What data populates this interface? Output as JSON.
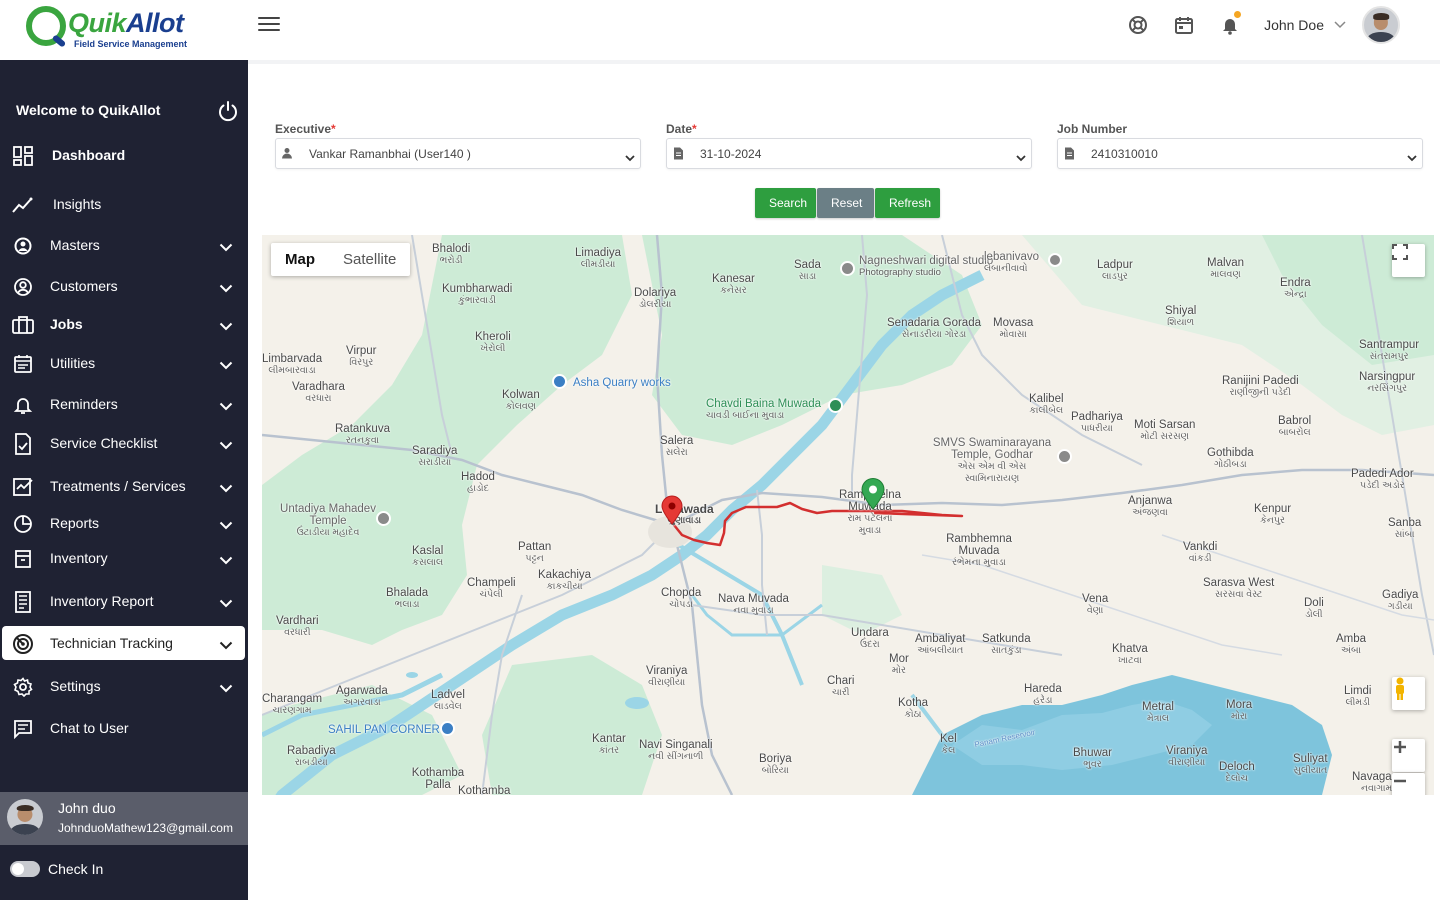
{
  "header": {
    "brand_name_part1": "Quik",
    "brand_name_part2": "Allot",
    "brand_tagline": "Field Service Management",
    "user_name": "John Doe",
    "accent_color": "#3aa53f"
  },
  "sidebar": {
    "welcome": "Welcome to QuikAllot",
    "items": [
      {
        "label": "Dashboard",
        "icon": "dashboard-icon"
      },
      {
        "label": "Insights",
        "icon": "insights-icon"
      },
      {
        "label": "Masters",
        "icon": "masters-icon"
      },
      {
        "label": "Customers",
        "icon": "customers-icon"
      },
      {
        "label": "Jobs",
        "icon": "jobs-icon"
      },
      {
        "label": "Utilities",
        "icon": "utilities-icon"
      },
      {
        "label": "Reminders",
        "icon": "bell-icon"
      },
      {
        "label": "Service Checklist",
        "icon": "checklist-icon"
      },
      {
        "label": "Treatments / Services",
        "icon": "treatments-icon"
      },
      {
        "label": "Reports",
        "icon": "reports-icon"
      },
      {
        "label": "Inventory",
        "icon": "inventory-icon"
      },
      {
        "label": "Inventory Report",
        "icon": "inventory-report-icon"
      },
      {
        "label": "Technician Tracking",
        "icon": "tracking-icon",
        "active": true
      },
      {
        "label": "Settings",
        "icon": "gear-icon"
      },
      {
        "label": "Chat to User",
        "icon": "chat-icon"
      }
    ],
    "user": {
      "name": "John duo",
      "email": "JohnduoMathew123@gmail.com"
    },
    "checkin_label": "Check In"
  },
  "filters": {
    "executive": {
      "label": "Executive",
      "value": "Vankar Ramanbhai (User140 )"
    },
    "date": {
      "label": "Date",
      "value": "31-10-2024"
    },
    "job_number": {
      "label": "Job Number",
      "value": "2410310010"
    },
    "required_mark": "*"
  },
  "buttons": {
    "search": "Search",
    "reset": "Reset",
    "refresh": "Refresh"
  },
  "map": {
    "type_map": "Map",
    "type_satellite": "Satellite",
    "places": [
      {
        "name": "Bhalodi",
        "sub": "ભરોડી"
      },
      {
        "name": "Limadiya",
        "sub": "લીમડીયા"
      },
      {
        "name": "Kanesar",
        "sub": "કનેસર"
      },
      {
        "name": "Sada",
        "sub": "સાડા"
      },
      {
        "name": "Nagneshwari digital studio",
        "sub": "Photography studio"
      },
      {
        "name": "lebanivavo",
        "sub": "લેબાનીવાવો"
      },
      {
        "name": "Ladpur",
        "sub": "લાડપુર"
      },
      {
        "name": "Malvan",
        "sub": "માલવણ"
      },
      {
        "name": "Endra",
        "sub": "એન્દ્રા"
      },
      {
        "name": "Kumbharwadi",
        "sub": "કુંભારવાડી"
      },
      {
        "name": "Dolariya",
        "sub": "ડોલરીયા"
      },
      {
        "name": "Shiyal",
        "sub": "શિયાળ"
      },
      {
        "name": "Kheroli",
        "sub": "ખેરોલી"
      },
      {
        "name": "Senadaria Gorada",
        "sub": "સેનાડરીયા ગોરડા"
      },
      {
        "name": "Movasa",
        "sub": "મોવાસા"
      },
      {
        "name": "Santrampur",
        "sub": "સંતરામપુર"
      },
      {
        "name": "Limbarvada",
        "sub": "લીમબારવાડા"
      },
      {
        "name": "Virpur",
        "sub": "વિરપુર"
      },
      {
        "name": "Asha Quarry works",
        "sub": ""
      },
      {
        "name": "Narsingpur",
        "sub": "નરસિંગપુર"
      },
      {
        "name": "Varadhara",
        "sub": "વરધારા"
      },
      {
        "name": "Kolwan",
        "sub": "કોલવણ"
      },
      {
        "name": "Chavdi Baina Muwada",
        "sub": "ચાવડી બાઈના મુવાડા"
      },
      {
        "name": "Ranijini Padedi",
        "sub": "રાણીજીની પડેદી"
      },
      {
        "name": "Kalibel",
        "sub": "કાલીબેલ"
      },
      {
        "name": "Padhariya",
        "sub": "પાધરીયા"
      },
      {
        "name": "Moti Sarsan",
        "sub": "મોટી સરસણ"
      },
      {
        "name": "Babrol",
        "sub": "બાબરોલ"
      },
      {
        "name": "Ratankuva",
        "sub": "રતનકુવા"
      },
      {
        "name": "Salera",
        "sub": "સલેરા"
      },
      {
        "name": "SMVS Swaminarayana Temple, Godhar",
        "sub": "એસ એમ વી એસ સ્વામિનારાયણ"
      },
      {
        "name": "Gothibda",
        "sub": "ગોઠીબડા"
      },
      {
        "name": "Saradiya",
        "sub": "સરાડીયા"
      },
      {
        "name": "Hadod",
        "sub": "હાડોદ"
      },
      {
        "name": "Padedi Ador",
        "sub": "પડેદી અડોર"
      },
      {
        "name": "Lunawada",
        "sub": "લુણાવાડા"
      },
      {
        "name": "Rampatelna Muwada",
        "sub": "રામ પટેલના મુવાડા"
      },
      {
        "name": "Anjanwa",
        "sub": "અંજણવા"
      },
      {
        "name": "Kenpur",
        "sub": "કેનપુર"
      },
      {
        "name": "Untadiya Mahadev Temple",
        "sub": "ઉંટાડીયા મહાદેવ"
      },
      {
        "name": "Sanba",
        "sub": "સાંબા"
      },
      {
        "name": "Pattan",
        "sub": "પટ્ટન"
      },
      {
        "name": "Kaslal",
        "sub": "કસલાલ"
      },
      {
        "name": "Rambhemna Muvada",
        "sub": "રંભેમના મુવાડા"
      },
      {
        "name": "Vankdi",
        "sub": "વાંકડી"
      },
      {
        "name": "Kakachiya",
        "sub": "કાકચીયા"
      },
      {
        "name": "Champeli",
        "sub": "ચંપેલી"
      },
      {
        "name": "Bhalada",
        "sub": "ભલાડા"
      },
      {
        "name": "Chopda",
        "sub": "ચોપડા"
      },
      {
        "name": "Nava Muvada",
        "sub": "નવા મુવાડા"
      },
      {
        "name": "Sarasva West",
        "sub": "સરસવા વેસ્ટ"
      },
      {
        "name": "Gadiya",
        "sub": "ગડીયા"
      },
      {
        "name": "Vena",
        "sub": "વેણા"
      },
      {
        "name": "Doli",
        "sub": "ડોલી"
      },
      {
        "name": "Vardhari",
        "sub": "વરધારી"
      },
      {
        "name": "Undara",
        "sub": "ઉંદરા"
      },
      {
        "name": "Ambaliyat",
        "sub": "આંબલીયાત"
      },
      {
        "name": "Satkunda",
        "sub": "સાતકુંડા"
      },
      {
        "name": "Amba",
        "sub": "અંબા"
      },
      {
        "name": "Khatva",
        "sub": "ખાટવા"
      },
      {
        "name": "Mor",
        "sub": "મોર"
      },
      {
        "name": "Viraniya",
        "sub": "વીરાણીયા"
      },
      {
        "name": "Chari",
        "sub": "ચારી"
      },
      {
        "name": "Hareda",
        "sub": "હરેડા"
      },
      {
        "name": "Limdi",
        "sub": "લીમડી"
      },
      {
        "name": "Charangam",
        "sub": "ચારણગામ"
      },
      {
        "name": "Agarwada",
        "sub": "અગરવાડા"
      },
      {
        "name": "Ladvel",
        "sub": "લાડવેલ"
      },
      {
        "name": "Kotha",
        "sub": "કોઠા"
      },
      {
        "name": "Metral",
        "sub": "મેત્રાલ"
      },
      {
        "name": "Mora",
        "sub": "મોરા"
      },
      {
        "name": "SAHIL PAN CORNER",
        "sub": ""
      },
      {
        "name": "Kel",
        "sub": "કેલ"
      },
      {
        "name": "Rabadiya",
        "sub": "રાબડીયા"
      },
      {
        "name": "Kantar",
        "sub": "કાંતર"
      },
      {
        "name": "Navi Singanali",
        "sub": "નવી સીંગનાળી"
      },
      {
        "name": "Boriya",
        "sub": "બોરિયા"
      },
      {
        "name": "Bhuwar",
        "sub": "ભુવર"
      },
      {
        "name": "Viraniya",
        "sub": "વીરાણીયા"
      },
      {
        "name": "Deloch",
        "sub": "દેલોચ"
      },
      {
        "name": "Suliyat",
        "sub": "સુલીયાત"
      },
      {
        "name": "Navagam",
        "sub": "નવાગામ"
      },
      {
        "name": "Kothamba Palla",
        "sub": ""
      },
      {
        "name": "Kothamba",
        "sub": ""
      },
      {
        "name": "Panam Reservoir",
        "sub": ""
      }
    ],
    "markers": [
      {
        "type": "start",
        "color": "#e53935"
      },
      {
        "type": "current",
        "color": "#34a853"
      }
    ],
    "route_color": "#d32f2f"
  }
}
